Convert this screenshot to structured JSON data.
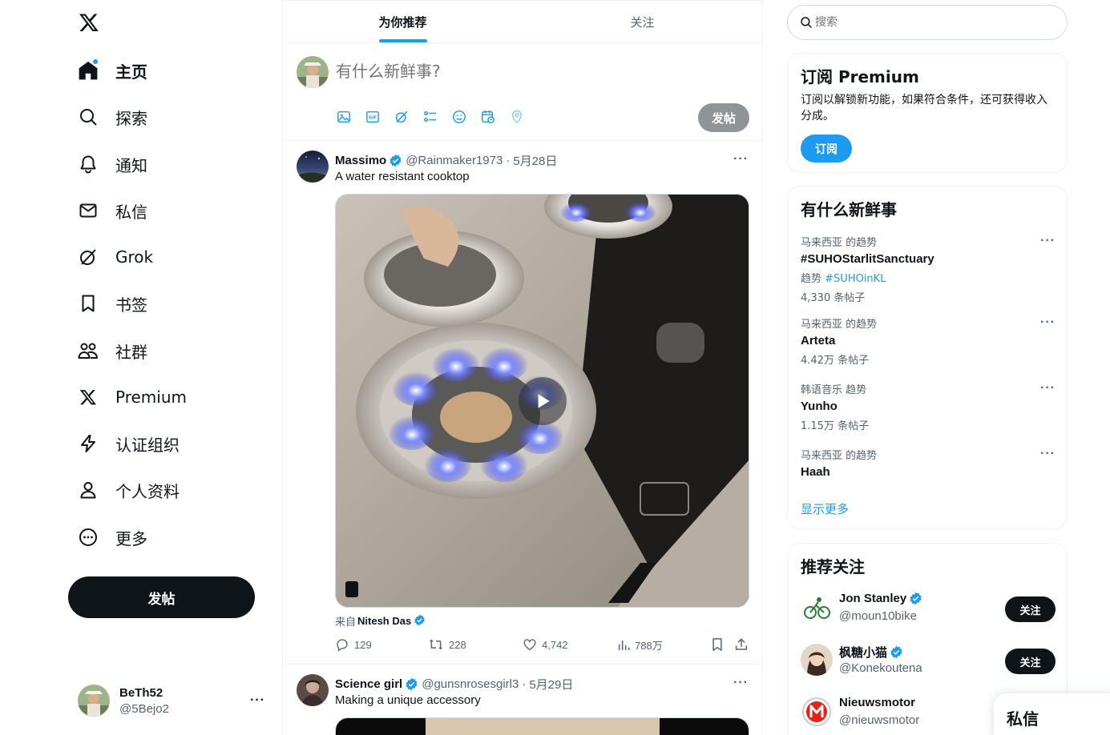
{
  "nav": {
    "items": [
      {
        "label": "主页",
        "icon": "home-icon"
      },
      {
        "label": "探索",
        "icon": "search-icon"
      },
      {
        "label": "通知",
        "icon": "bell-icon"
      },
      {
        "label": "私信",
        "icon": "mail-icon"
      },
      {
        "label": "Grok",
        "icon": "grok-icon"
      },
      {
        "label": "书签",
        "icon": "bookmark-icon"
      },
      {
        "label": "社群",
        "icon": "communities-icon"
      },
      {
        "label": "Premium",
        "icon": "x-logo-icon"
      },
      {
        "label": "认证组织",
        "icon": "lightning-icon"
      },
      {
        "label": "个人资料",
        "icon": "person-icon"
      },
      {
        "label": "更多",
        "icon": "more-circle-icon"
      }
    ],
    "post_label": "发帖"
  },
  "account": {
    "name": "BeTh52",
    "handle": "@5Bejo2"
  },
  "tabs": [
    {
      "label": "为你推荐"
    },
    {
      "label": "关注"
    }
  ],
  "composer": {
    "placeholder": "有什么新鲜事?",
    "send_label": "发帖"
  },
  "tweets": [
    {
      "name": "Massimo",
      "handle": "@Rainmaker1973",
      "date": "5月28日",
      "text": "A water resistant cooktop",
      "from_prefix": "来自",
      "from_name": "Nitesh Das",
      "replies": "129",
      "retweets": "228",
      "likes": "4,742",
      "views": "788万"
    },
    {
      "name": "Science girl",
      "handle": "@gunsnrosesgirl3",
      "date": "5月29日",
      "text": "Making a unique accessory"
    }
  ],
  "search": {
    "placeholder": "搜索"
  },
  "premium": {
    "title": "订阅 Premium",
    "text": "订阅以解锁新功能，如果符合条件，还可获得收入分成。",
    "button": "订阅"
  },
  "trends": {
    "title": "有什么新鲜事",
    "items": [
      {
        "context": "马来西亚 的趋势",
        "title": "#SUHOStarlitSanctuary",
        "sub_prefix": "趋势",
        "sub_tag": "#SUHOinKL",
        "count": "4,330 条帖子"
      },
      {
        "context": "马来西亚 的趋势",
        "title": "Arteta",
        "count": "4.42万 条帖子"
      },
      {
        "context": "韩语音乐 趋势",
        "title": "Yunho",
        "count": "1.15万 条帖子"
      },
      {
        "context": "马来西亚 的趋势",
        "title": "Haah",
        "count": ""
      }
    ],
    "show_more": "显示更多"
  },
  "who_to_follow": {
    "title": "推荐关注",
    "items": [
      {
        "name": "Jon Stanley",
        "handle": "@moun10bike",
        "button": "关注"
      },
      {
        "name": "枫糖小猫",
        "handle": "@Konekoutena",
        "button": "关注"
      },
      {
        "name": "Nieuwsmotor",
        "handle": "@nieuwsmotor",
        "button": ""
      }
    ]
  },
  "dm_drawer": {
    "label": "私信"
  },
  "colors": {
    "accent": "#1d9bf0",
    "text": "#0f1419",
    "muted": "#536471",
    "border": "#eff3f4"
  }
}
